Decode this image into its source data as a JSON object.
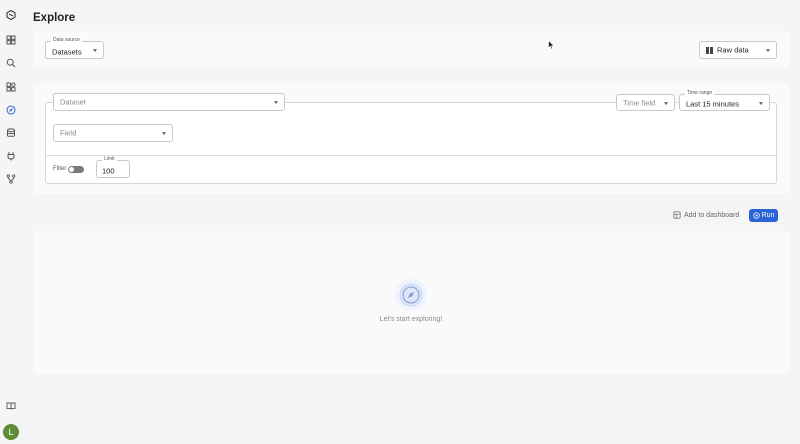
{
  "page": {
    "title": "Explore"
  },
  "sidebar": {
    "items": [
      {
        "icon": "logo-icon"
      },
      {
        "icon": "dashboard-icon"
      },
      {
        "icon": "search-icon"
      },
      {
        "icon": "templates-icon"
      },
      {
        "icon": "explore-icon",
        "active": true
      },
      {
        "icon": "database-icon"
      },
      {
        "icon": "integrations-icon"
      },
      {
        "icon": "pipeline-icon"
      },
      {
        "icon": "docs-icon"
      }
    ],
    "avatar_letter": "L"
  },
  "source_bar": {
    "data_source_label": "Data source",
    "data_source_value": "Datasets",
    "view_mode_label": "Raw data"
  },
  "query": {
    "dataset_placeholder": "Dataset",
    "time_field_placeholder": "Time field",
    "time_range_label": "Time range",
    "time_range_value": "Last 15 minutes",
    "field_placeholder": "Field",
    "filter_label": "Filter",
    "limit_label": "Limit",
    "limit_value": "100"
  },
  "actions": {
    "add_to_dashboard": "Add to dashboard",
    "run": "Run"
  },
  "results": {
    "empty_message": "Let's start exploring!"
  },
  "colors": {
    "accent": "#2a63d6",
    "avatar": "#5f8a37",
    "active_nav": "#3b6fd8"
  }
}
